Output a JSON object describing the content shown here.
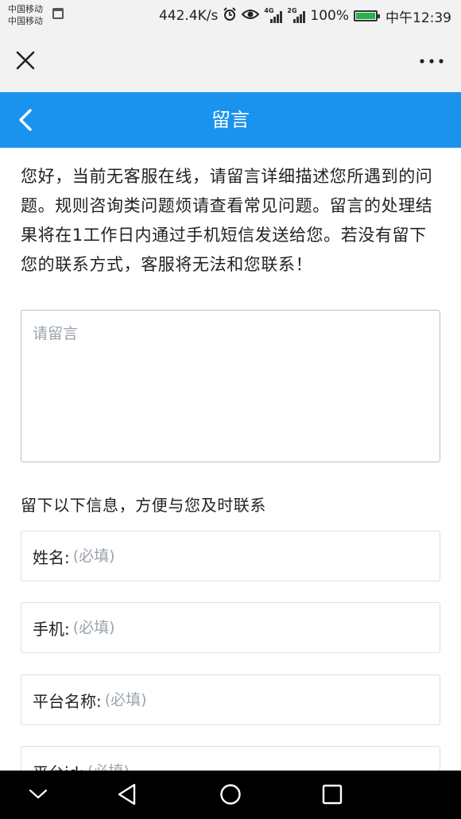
{
  "status_bar": {
    "carrier_1": "中国移动",
    "carrier_2": "中国移动",
    "net_speed": "442.4K/s",
    "signal_1_tag": "4G",
    "signal_2_tag": "2G",
    "battery_percent": "100%",
    "battery_level": 1.0,
    "time": "中午12:39"
  },
  "wx_bar": {
    "close_icon": "close-icon",
    "more_icon": "more-dots-icon"
  },
  "header": {
    "title": "留言",
    "back_icon": "chevron-left-icon",
    "color": "#1a93ee"
  },
  "notice": "您好，当前无客服在线，请留言详细描述您所遇到的问题。规则咨询类问题烦请查看常见问题。留言的处理结果将在1工作日内通过手机短信发送给您。若没有留下您的联系方式，客服将无法和您联系！",
  "message": {
    "placeholder": "请留言",
    "value": ""
  },
  "info_heading": "留下以下信息，方便与您及时联系",
  "fields": [
    {
      "label": "姓名:",
      "placeholder": "(必填)",
      "value": ""
    },
    {
      "label": "手机:",
      "placeholder": "(必填)",
      "value": ""
    },
    {
      "label": "平台名称:",
      "placeholder": "(必填)",
      "value": ""
    },
    {
      "label": "平台id:",
      "placeholder": "(必填)",
      "value": ""
    }
  ],
  "nav_bar": {
    "icons": [
      "chevron-down-icon",
      "back-triangle-icon",
      "home-circle-icon",
      "recents-square-icon"
    ]
  }
}
